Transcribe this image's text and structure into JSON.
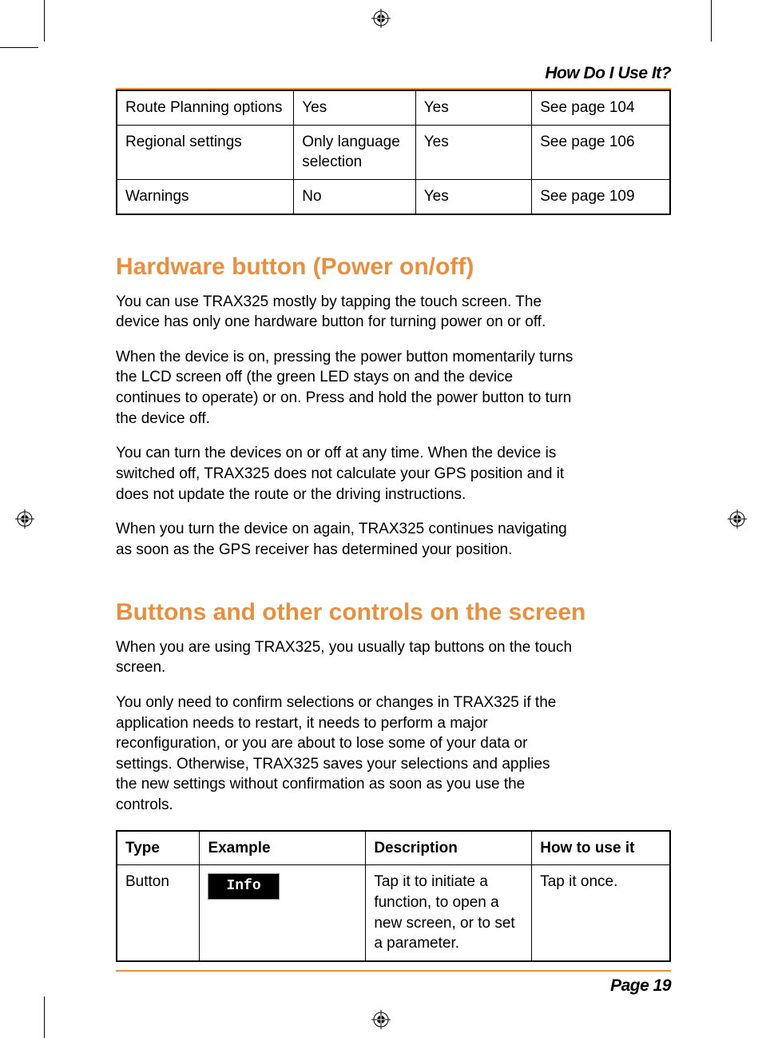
{
  "header": {
    "title": "How Do I Use It?"
  },
  "table1": {
    "rows": [
      {
        "c1": "Route Planning options",
        "c2": "Yes",
        "c3": "Yes",
        "c4": "See page 104"
      },
      {
        "c1": "Regional settings",
        "c2": "Only language selection",
        "c3": "Yes",
        "c4": "See page 106"
      },
      {
        "c1": "Warnings",
        "c2": "No",
        "c3": "Yes",
        "c4": "See page 109"
      }
    ]
  },
  "section1": {
    "heading": "Hardware button (Power on/off)",
    "p1": "You can use TRAX325 mostly by tapping the touch screen. The device has only one hardware button for turning power on or off.",
    "p2": "When the device is on, pressing the power button momentarily turns the LCD screen off (the green LED stays on and the device continues to operate) or on. Press and hold the power button to turn the device off.",
    "p3": "You can turn the devices on or off at any time. When the device is switched off, TRAX325 does not calculate your GPS position and it does not update the route or the driving instructions.",
    "p4": "When you turn the device on again, TRAX325 continues navigating as soon as the GPS receiver has determined your position."
  },
  "section2": {
    "heading": "Buttons and other controls on the screen",
    "p1": "When you are using TRAX325, you usually tap buttons on the touch screen.",
    "p2": "You only need to confirm selections or changes in TRAX325 if the application needs to restart, it needs to perform a major reconfiguration, or you are about to lose some of your data or settings. Otherwise, TRAX325 saves your selections and applies the new settings without confirmation as soon as you use the controls."
  },
  "table2": {
    "headers": {
      "h1": "Type",
      "h2": "Example",
      "h3": "Description",
      "h4": "How to use it"
    },
    "row1": {
      "type": "Button",
      "example_label": "Info",
      "description": "Tap it to initiate a function, to open a new screen, or to set a parameter.",
      "how": "Tap it once."
    }
  },
  "footer": {
    "page": "Page 19"
  }
}
